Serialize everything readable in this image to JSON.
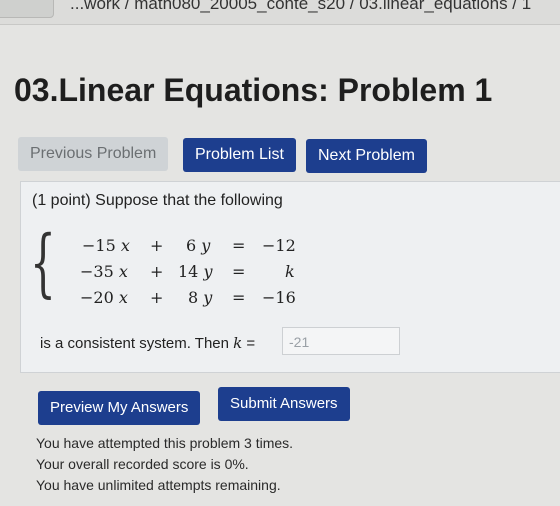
{
  "header": {
    "breadcrumb": "...work / math080_20005_conte_s20 / 03.linear_equations / 1"
  },
  "page_title": "03.Linear Equations: Problem 1",
  "nav": {
    "previous_label": "Previous Problem",
    "list_label": "Problem List",
    "next_label": "Next Problem"
  },
  "problem": {
    "intro": "(1 point) Suppose that the following",
    "equations": [
      {
        "a": "−15",
        "op1": "+",
        "b": "6",
        "rhs": "−12"
      },
      {
        "a": "−35",
        "op1": "+",
        "b": "14",
        "rhs": "k"
      },
      {
        "a": "−20",
        "op1": "+",
        "b": "8",
        "rhs": "−16"
      }
    ],
    "var_x": "x",
    "var_y": "y",
    "eq_sign": "=",
    "answer_prefix": "is a consistent system. Then",
    "answer_var": "k",
    "answer_eq": "=",
    "answer_value": "-21"
  },
  "actions": {
    "preview_label": "Preview My Answers",
    "submit_label": "Submit Answers"
  },
  "status": {
    "attempts": "You have attempted this problem 3 times.",
    "score": "Your overall recorded score is 0%.",
    "remaining": "You have unlimited attempts remaining."
  },
  "colors": {
    "primary_button": "#1d3e8e",
    "disabled_button": "#cfd3d6",
    "page_background": "#e4e4e2"
  }
}
